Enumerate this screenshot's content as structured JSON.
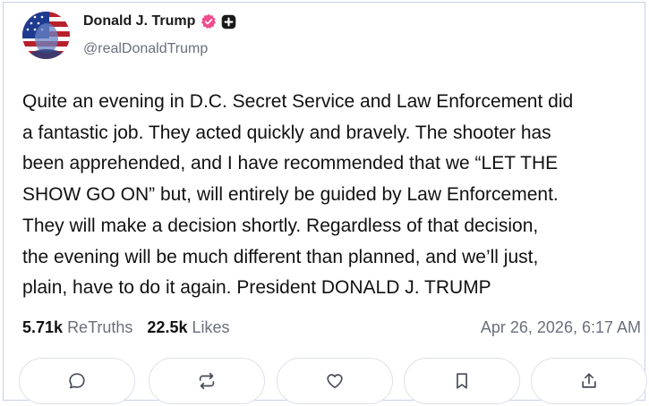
{
  "author": {
    "name": "Donald J. Trump",
    "handle": "@realDonaldTrump",
    "avatar_icon": "flag-portrait-avatar",
    "verified_icon": "verified-badge-icon",
    "plus_icon": "plus-badge-icon"
  },
  "post": {
    "text": "Quite an evening in D.C. Secret Service and Law Enforcement did\na fantastic job. They acted quickly and bravely. The shooter has\nbeen apprehended, and I have recommended that we “LET THE\nSHOW GO ON” but, will entirely be guided by Law Enforcement.\nThey will make a decision shortly. Regardless of that decision,\nthe evening will be much different than planned, and we’ll just,\nplain, have to do it again. President DONALD J. TRUMP"
  },
  "stats": {
    "retruths_count": "5.71k",
    "retruths_label": "ReTruths",
    "likes_count": "22.5k",
    "likes_label": "Likes"
  },
  "timestamp": "Apr 26, 2026, 6:17 AM",
  "actions": [
    {
      "icon": "reply-icon"
    },
    {
      "icon": "retruth-icon"
    },
    {
      "icon": "heart-icon"
    },
    {
      "icon": "bookmark-icon"
    },
    {
      "icon": "share-icon"
    }
  ],
  "colors": {
    "verified": "#f04d8c",
    "muted_text": "#6b6f7a",
    "border": "#c9cfea"
  }
}
